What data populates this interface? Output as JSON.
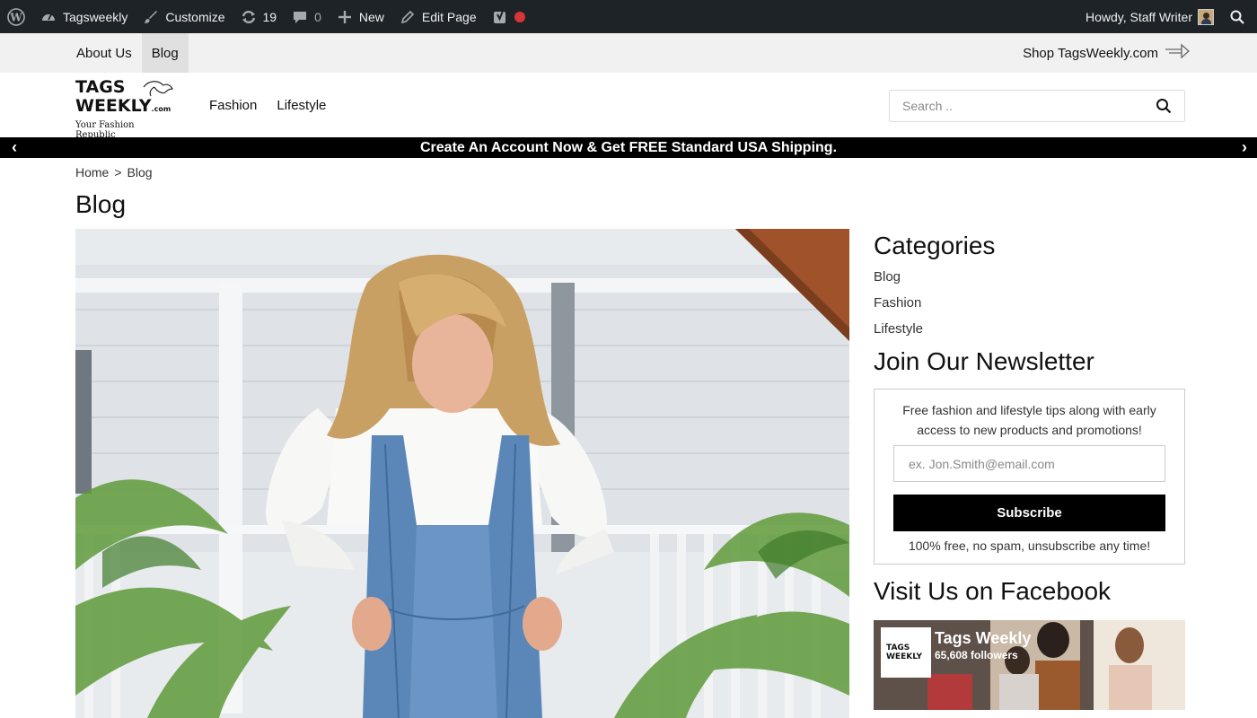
{
  "admin_bar": {
    "site_name": "Tagsweekly",
    "customize": "Customize",
    "updates_count": "19",
    "comments_count": "0",
    "new_label": "New",
    "edit_page": "Edit Page",
    "howdy": "Howdy, Staff Writer"
  },
  "top_nav": {
    "links": [
      "About Us",
      "Blog"
    ],
    "active": "Blog",
    "shop_link": "Shop TagsWeekly.com"
  },
  "header": {
    "logo_line1": "TAGS",
    "logo_line2": "WEEKLY",
    "logo_com": ".com",
    "logo_tagline": "Your Fashion Republic",
    "nav": [
      "Fashion",
      "Lifestyle"
    ],
    "search_placeholder": "Search .."
  },
  "announcement": {
    "text": "Create An Account Now & Get FREE Standard USA Shipping.",
    "prev": "‹",
    "next": "›"
  },
  "breadcrumb": {
    "home": "Home",
    "separator": ">",
    "current": "Blog"
  },
  "page_title": "Blog",
  "sidebar": {
    "categories_title": "Categories",
    "categories": [
      "Blog",
      "Fashion",
      "Lifestyle"
    ],
    "newsletter_title": "Join Our Newsletter",
    "newsletter_text": "Free fashion and lifestyle tips along with early access to new products and promotions!",
    "email_placeholder": "ex. Jon.Smith@email.com",
    "subscribe_label": "Subscribe",
    "newsletter_note": "100% free, no spam, unsubscribe any time!",
    "facebook_title": "Visit Us on Facebook",
    "facebook_page_name": "Tags Weekly",
    "facebook_followers": "65,608 followers"
  },
  "colors": {
    "admin_bar_bg": "#1d2327",
    "top_nav_bg": "#f1f1f1",
    "announcement_bg": "#000000",
    "subscribe_bg": "#000000"
  }
}
